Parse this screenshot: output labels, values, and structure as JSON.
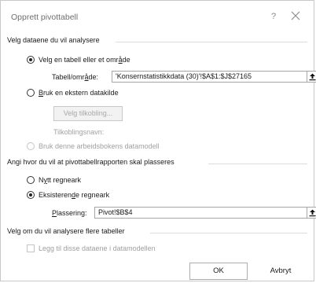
{
  "dialog": {
    "title": "Opprett pivottabell",
    "help": "?",
    "close_icon": "close-icon"
  },
  "section1": {
    "heading": "Velg dataene du vil analysere",
    "option_table": {
      "label_a": "Velg en tabell eller et omr",
      "label_u": "å",
      "label_b": "de",
      "selected": true
    },
    "table_range": {
      "label_a": "Tabell/omr",
      "label_u": "å",
      "label_b": "de:",
      "value": "'Konsernstatistikkdata (30)'!$A$1:$J$27165"
    },
    "option_external": {
      "label_u": "B",
      "label_b": "ruk en ekstern datakilde",
      "selected": false
    },
    "choose_connection": "Velg tilkobling...",
    "connection_name": "Tilkoblingsnavn:",
    "option_datamodel": {
      "label": "Bruk denne arbeidsbokens datamodell",
      "enabled": false
    }
  },
  "section2": {
    "heading": "Angi hvor du vil at pivottabellrapporten skal plasseres",
    "option_new": {
      "label_a": "N",
      "label_u": "y",
      "label_b": "tt regneark",
      "selected": false
    },
    "option_existing": {
      "label_a": "Eksisteren",
      "label_u": "d",
      "label_b": "e regneark",
      "selected": true
    },
    "location": {
      "label_u": "P",
      "label_b": "lassering:",
      "value": "Pivot!$B$4"
    }
  },
  "section3": {
    "heading": "Velg om du vil analysere flere tabeller",
    "add_to_model": {
      "label": "Legg til disse dataene i datamodellen",
      "checked": false,
      "enabled": false
    }
  },
  "buttons": {
    "ok": "OK",
    "cancel": "Avbryt"
  }
}
